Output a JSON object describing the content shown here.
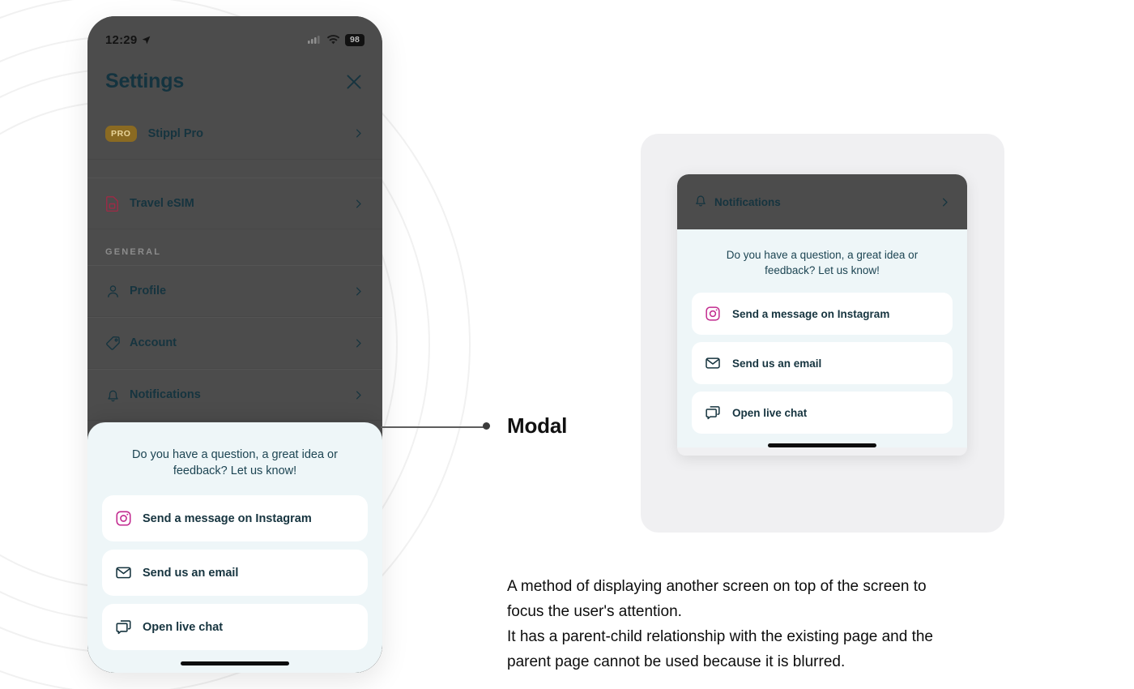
{
  "phone": {
    "status_bar": {
      "time": "12:29",
      "location_icon": "location-arrow-icon",
      "signal_icon": "cellular-signal-icon",
      "wifi_icon": "wifi-icon",
      "battery_level": "98"
    },
    "header": {
      "title": "Settings",
      "close_icon": "close-icon"
    },
    "top_items": [
      {
        "label": "Stippl Pro",
        "badge": "PRO",
        "icon": "pro-badge-icon",
        "chevron": "chevron-right-icon"
      },
      {
        "label": "Travel eSIM",
        "icon": "sim-card-icon",
        "chevron": "chevron-right-icon"
      }
    ],
    "group_title": "GENERAL",
    "general_items": [
      {
        "label": "Profile",
        "icon": "person-icon",
        "chevron": "chevron-right-icon"
      },
      {
        "label": "Account",
        "icon": "tag-icon",
        "chevron": "chevron-right-icon"
      },
      {
        "label": "Notifications",
        "icon": "bell-icon",
        "chevron": "chevron-right-icon"
      }
    ],
    "modal": {
      "prompt": "Do you have a question, a great idea or feedback? Let us know!",
      "options": [
        {
          "label": "Send a message on Instagram",
          "icon": "instagram-icon"
        },
        {
          "label": "Send us an email",
          "icon": "envelope-icon"
        },
        {
          "label": "Open live chat",
          "icon": "chat-bubbles-icon"
        }
      ],
      "home_indicator": "home-indicator"
    }
  },
  "callout": {
    "label": "Modal"
  },
  "detail_card": {
    "header": {
      "label": "Notifications",
      "icon": "bell-icon",
      "chevron": "chevron-right-icon"
    },
    "modal": {
      "prompt": "Do you have a question, a great idea or feedback? Let us know!",
      "options": [
        {
          "label": "Send a message on Instagram",
          "icon": "instagram-icon"
        },
        {
          "label": "Send us an email",
          "icon": "envelope-icon"
        },
        {
          "label": "Open live chat",
          "icon": "chat-bubbles-icon"
        }
      ],
      "home_indicator": "home-indicator"
    }
  },
  "description": {
    "line1": "A method of displaying another screen on top of the screen to",
    "line2": "focus the user's attention.",
    "line3": "It has a parent-child relationship with the existing page and the",
    "line4": "parent page cannot be used because it is blurred."
  },
  "colors": {
    "page_background": "#ffffff",
    "phone_dim": "#4c4c4c",
    "modal_sheet": "#eef6f8",
    "option_card": "#ffffff",
    "text_dark_teal": "#16343f",
    "detail_card_bg": "#f0f0f2",
    "instagram": "#c22a8f",
    "sim_card": "#9e2a46",
    "pro_badge_bg": "#8a6a22",
    "pro_badge_text": "#e8d49a",
    "callout_line": "#5d5d5d"
  }
}
